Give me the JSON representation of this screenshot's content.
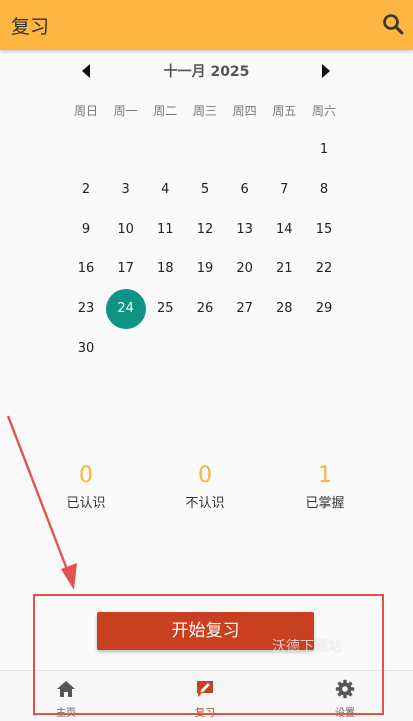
{
  "appbar": {
    "title": "复习",
    "search_icon": "search-icon",
    "color": "#ffb541"
  },
  "calendar": {
    "month_title": "十一月 2025",
    "prev_icon": "caret-left-icon",
    "next_icon": "caret-right-icon",
    "weekdays": [
      "周日",
      "周一",
      "周二",
      "周三",
      "周四",
      "周五",
      "周六"
    ],
    "days": [
      "1",
      "2",
      "3",
      "4",
      "5",
      "6",
      "7",
      "8",
      "9",
      "10",
      "11",
      "12",
      "13",
      "14",
      "15",
      "16",
      "17",
      "18",
      "19",
      "20",
      "21",
      "22",
      "23",
      "24",
      "25",
      "26",
      "27",
      "28",
      "29",
      "30"
    ],
    "today": "24",
    "today_color": "#0e9484"
  },
  "stats": [
    {
      "value": "0",
      "label": "已认识"
    },
    {
      "value": "0",
      "label": "不认识"
    },
    {
      "value": "1",
      "label": "已掌握"
    }
  ],
  "start_button": {
    "label": "开始复习",
    "color": "#c8401f"
  },
  "watermark": "沃德下载站",
  "bottom_nav": [
    {
      "label": "主页",
      "icon": "home-icon",
      "active": false
    },
    {
      "label": "复习",
      "icon": "review-icon",
      "active": true
    },
    {
      "label": "设置",
      "icon": "gear-icon",
      "active": false
    }
  ],
  "annotation_color": "#e2534f"
}
